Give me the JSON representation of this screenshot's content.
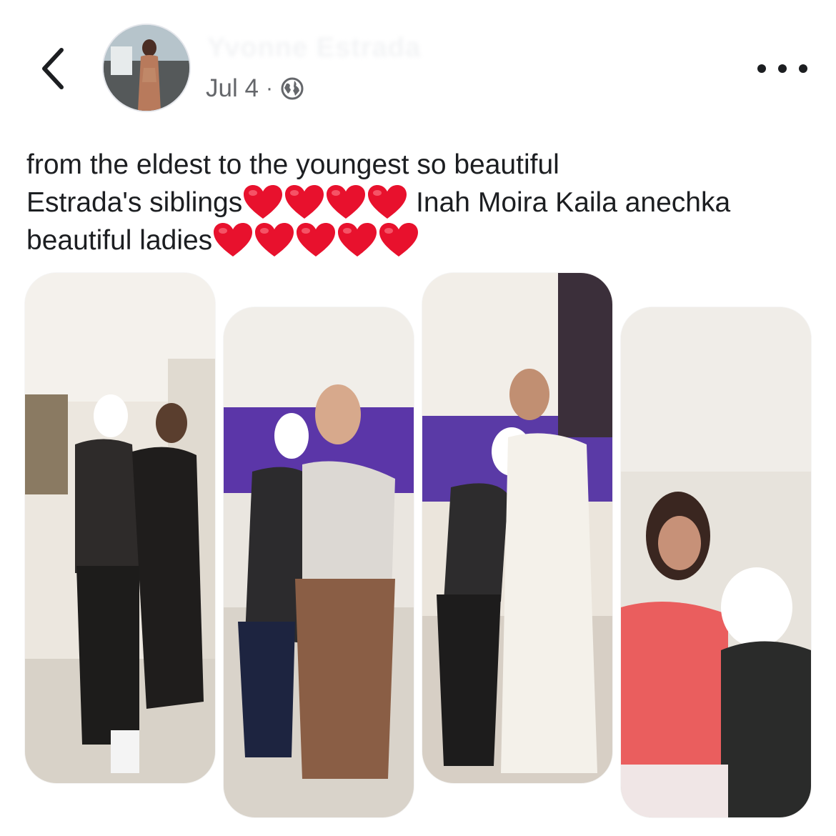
{
  "post": {
    "author_name": "Yvonne Estrada",
    "date": "Jul 4",
    "separator": "·",
    "audience_icon": "globe-icon",
    "caption_lines": [
      "from the eldest to the youngest so beautiful",
      "Estrada's siblings",
      " Inah Moira Kaila anechka",
      "beautiful ladies"
    ],
    "emoji": "red-heart"
  },
  "header": {
    "back_icon": "chevron-left-icon",
    "more_icon": "more-horizontal-icon"
  },
  "photos": [
    {
      "name": "photo-1",
      "description_icon": "photo"
    },
    {
      "name": "photo-2",
      "description_icon": "photo"
    },
    {
      "name": "photo-3",
      "description_icon": "photo"
    },
    {
      "name": "photo-4",
      "description_icon": "photo"
    }
  ],
  "colors": {
    "text": "#1c1e21",
    "secondary": "#65676b",
    "heart": "#e8112d"
  }
}
